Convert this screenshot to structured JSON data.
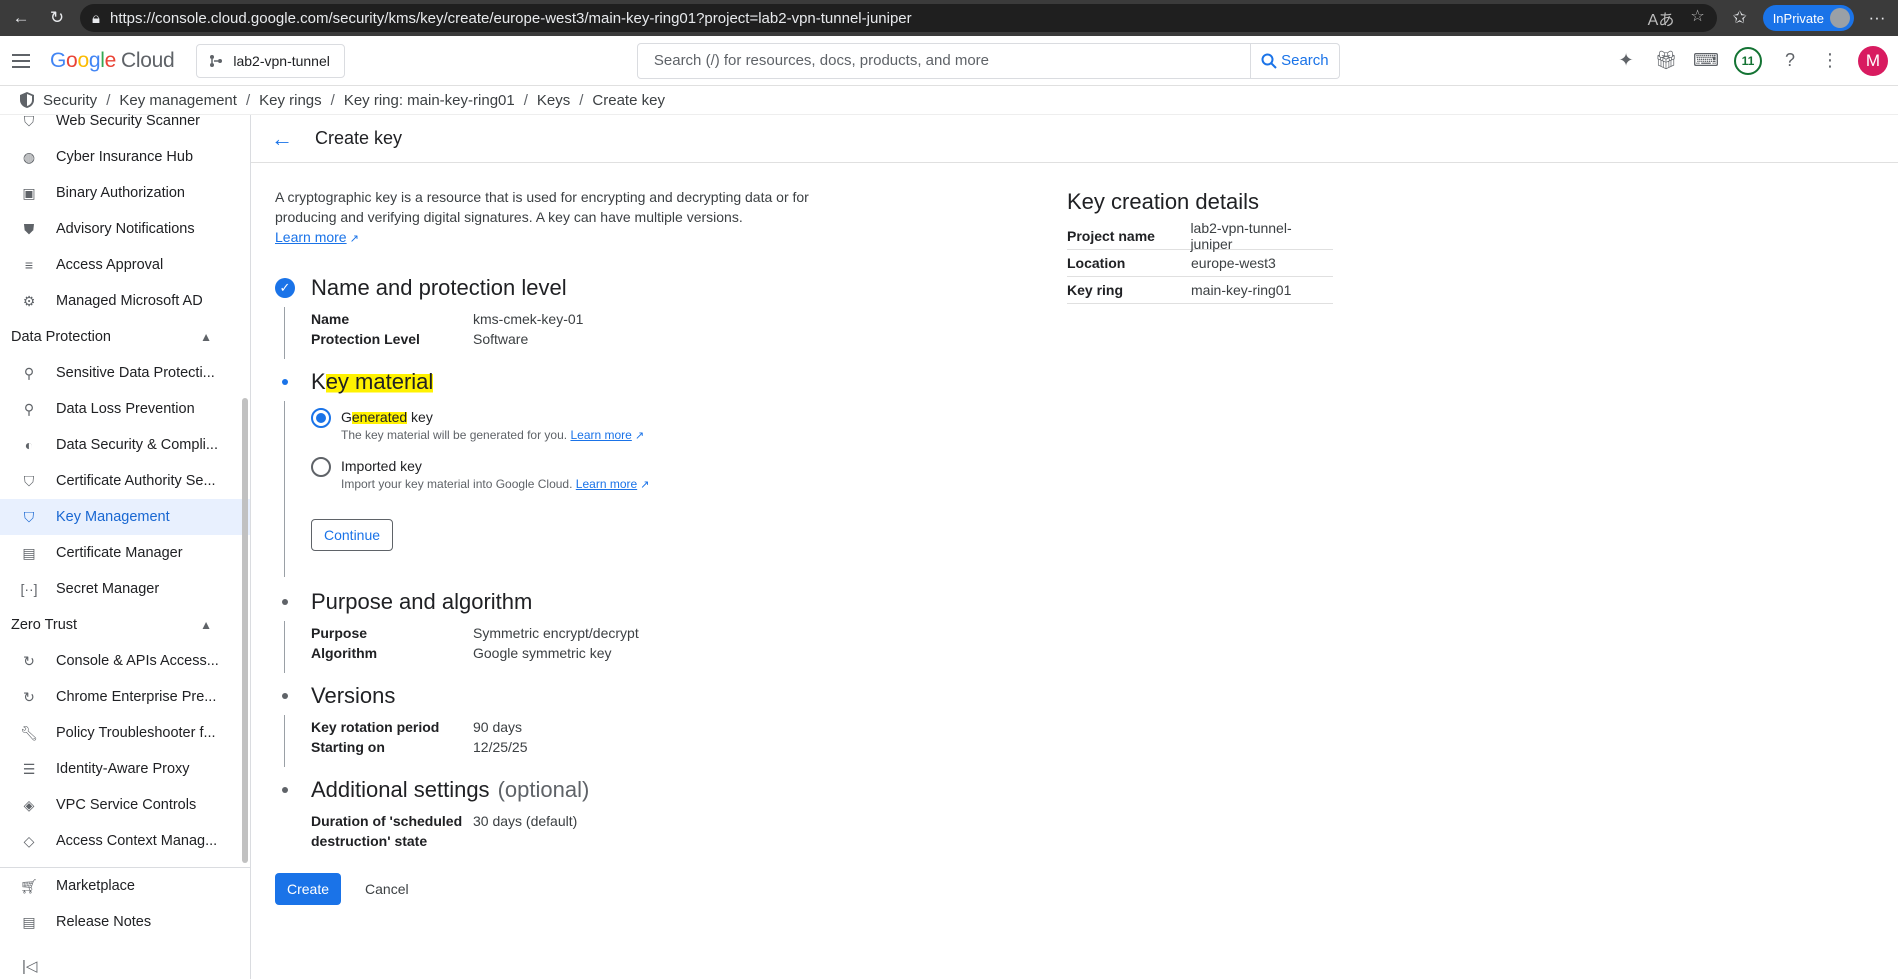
{
  "browser": {
    "url": "https://console.cloud.google.com/security/kms/key/create/europe-west3/main-key-ring01?project=lab2-vpn-tunnel-juniper",
    "inprivate_label": "InPrivate"
  },
  "header": {
    "logo_g": "G",
    "logo_o1": "o",
    "logo_o2": "o",
    "logo_g2": "g",
    "logo_l": "l",
    "logo_e": "e",
    "logo_cloud": "Cloud",
    "project": "lab2-vpn-tunnel",
    "search_placeholder": "Search (/) for resources, docs, products, and more",
    "search_button": "Search",
    "notification_count": "11",
    "avatar_letter": "M"
  },
  "breadcrumb": [
    "Security",
    "Key management",
    "Key rings",
    "Key ring: main-key-ring01",
    "Keys",
    "Create key"
  ],
  "sidebar": {
    "items_top": [
      {
        "label": "Web Security Scanner",
        "icon": "shield-icon"
      },
      {
        "label": "Cyber Insurance Hub",
        "icon": "globe-icon"
      },
      {
        "label": "Binary Authorization",
        "icon": "badge-icon"
      },
      {
        "label": "Advisory Notifications",
        "icon": "shield-outline-icon"
      },
      {
        "label": "Access Approval",
        "icon": "list-search-icon"
      },
      {
        "label": "Managed Microsoft AD",
        "icon": "hierarchy-icon"
      }
    ],
    "section_data_protection": "Data Protection",
    "items_dp": [
      {
        "label": "Sensitive Data Protecti...",
        "icon": "search-gear-icon"
      },
      {
        "label": "Data Loss Prevention",
        "icon": "search-icon"
      },
      {
        "label": "Data Security & Compli...",
        "icon": "half-shield-icon"
      },
      {
        "label": "Certificate Authority Se...",
        "icon": "cert-shield-icon"
      },
      {
        "label": "Key Management",
        "icon": "key-shield-icon"
      },
      {
        "label": "Certificate Manager",
        "icon": "certificate-icon"
      },
      {
        "label": "Secret Manager",
        "icon": "secret-icon"
      }
    ],
    "section_zero_trust": "Zero Trust",
    "items_zt": [
      {
        "label": "Console & APIs Access...",
        "icon": "circle-arrows-icon"
      },
      {
        "label": "Chrome Enterprise Pre...",
        "icon": "circle-arrows-icon"
      },
      {
        "label": "Policy Troubleshooter f...",
        "icon": "wrench-icon"
      },
      {
        "label": "Identity-Aware Proxy",
        "icon": "proxy-icon"
      },
      {
        "label": "VPC Service Controls",
        "icon": "layers-icon"
      },
      {
        "label": "Access Context Manag...",
        "icon": "diamond-icon"
      }
    ],
    "marketplace": "Marketplace",
    "release_notes": "Release Notes"
  },
  "page": {
    "title": "Create key",
    "intro": "A cryptographic key is a resource that is used for encrypting and decrypting data or for producing and verifying digital signatures. A key can have multiple versions.",
    "learn_more": "Learn more",
    "step1": {
      "title": "Name and protection level",
      "rows": [
        {
          "k": "Name",
          "v": "kms-cmek-key-01"
        },
        {
          "k": "Protection Level",
          "v": "Software"
        }
      ]
    },
    "step2": {
      "title": "Key material",
      "opt1_label_a": "G",
      "opt1_label_b": "enerated",
      "opt1_label_c": " key",
      "opt1_help": "The key material will be generated for you.",
      "opt2_label": "Imported key",
      "opt2_help": "Import your key material into Google Cloud.",
      "continue": "Continue"
    },
    "step3": {
      "title": "Purpose and algorithm",
      "rows": [
        {
          "k": "Purpose",
          "v": "Symmetric encrypt/decrypt"
        },
        {
          "k": "Algorithm",
          "v": "Google symmetric key"
        }
      ]
    },
    "step4": {
      "title": "Versions",
      "rows": [
        {
          "k": "Key rotation period",
          "v": "90 days"
        },
        {
          "k": "Starting on",
          "v": "12/25/25"
        }
      ]
    },
    "step5": {
      "title": "Additional settings",
      "optional": "(optional)",
      "row_k": "Duration of 'scheduled destruction' state",
      "row_v": "30 days (default)"
    },
    "create": "Create",
    "cancel": "Cancel"
  },
  "details": {
    "title": "Key creation details",
    "rows": [
      {
        "k": "Project name",
        "v": "lab2-vpn-tunnel-juniper"
      },
      {
        "k": "Location",
        "v": "europe-west3"
      },
      {
        "k": "Key ring",
        "v": "main-key-ring01"
      }
    ]
  }
}
